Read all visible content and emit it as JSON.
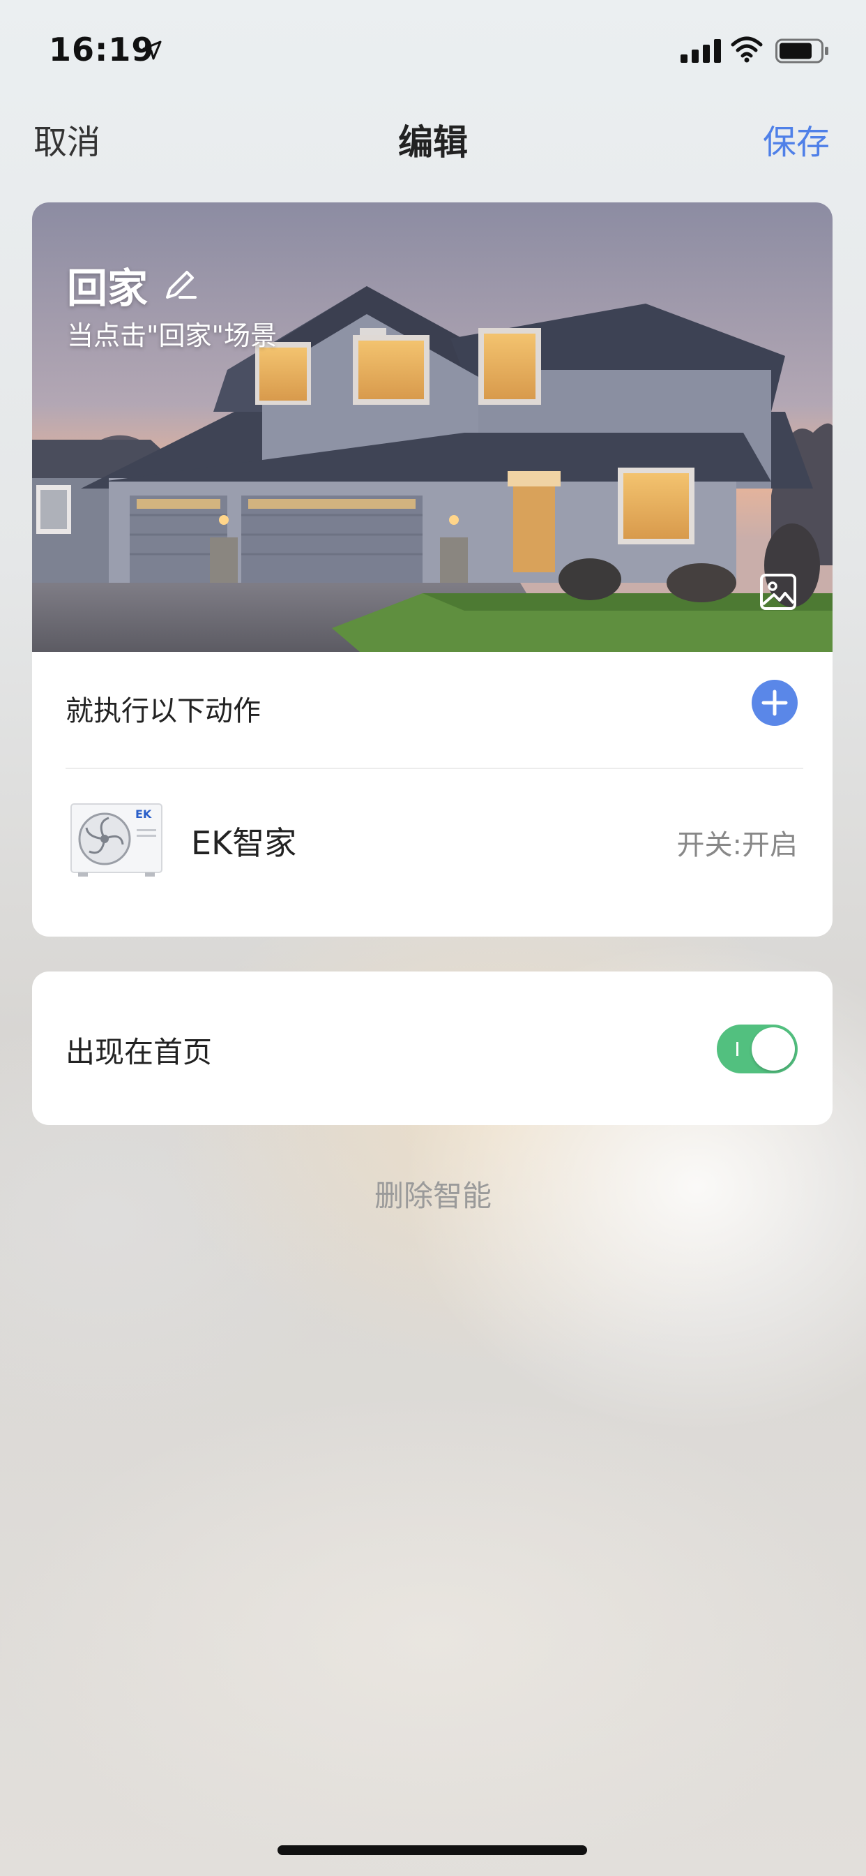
{
  "status_bar": {
    "time": "16:19",
    "icons": [
      "location-arrow-icon",
      "signal-icon",
      "wifi-icon",
      "battery-icon"
    ]
  },
  "nav": {
    "cancel": "取消",
    "title": "编辑",
    "save": "保存",
    "save_color": "#4f80e8"
  },
  "scene": {
    "title": "回家",
    "subtitle": "当点击\"回家\"场景",
    "icons": [
      "edit-icon",
      "image-icon"
    ]
  },
  "actions": {
    "header": "就执行以下动作",
    "add_icon": "plus-icon",
    "items": [
      {
        "name": "EK智家",
        "state": "开关:开启",
        "device_logo": "EK"
      }
    ]
  },
  "home_toggle": {
    "label": "出现在首页",
    "on": true,
    "color": "#52c07f"
  },
  "delete": "删除智能"
}
